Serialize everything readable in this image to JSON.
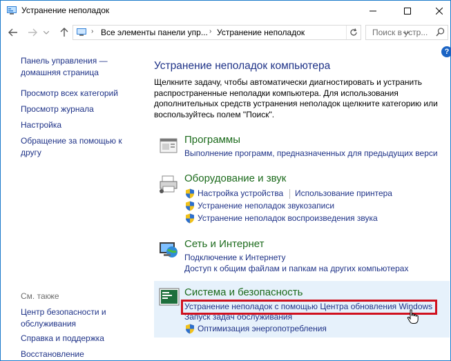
{
  "window": {
    "title": "Устранение неполадок"
  },
  "address": {
    "crumbs": [
      "Все элементы панели упр...",
      "Устранение неполадок"
    ],
    "search_placeholder": "Поиск в устр..."
  },
  "sidebar": {
    "items": [
      {
        "label": "Панель управления — домашняя страница"
      },
      {
        "label": "Просмотр всех категорий"
      },
      {
        "label": "Просмотр журнала"
      },
      {
        "label": "Настройка"
      },
      {
        "label": "Обращение за помощью к другу"
      }
    ],
    "see_also_label": "См. также",
    "see_also": [
      {
        "label": "Центр безопасности и обслуживания"
      },
      {
        "label": "Справка и поддержка"
      },
      {
        "label": "Восстановление"
      }
    ]
  },
  "main": {
    "title": "Устранение неполадок компьютера",
    "description": "Щелкните задачу, чтобы автоматически диагностировать и устранить распространенные неполадки компьютера. Для использования дополнительных средств устранения неполадок щелкните категорию или воспользуйтесь полем \"Поиск\".",
    "categories": [
      {
        "title": "Программы",
        "links": [
          "Выполнение программ, предназначенных для предыдущих верси"
        ]
      },
      {
        "title": "Оборудование и звук",
        "links": [
          "Настройка устройства",
          "Использование принтера",
          "Устранение неполадок звукозаписи",
          "Устранение неполадок воспроизведения звука"
        ]
      },
      {
        "title": "Сеть и Интернет",
        "links": [
          "Подключение к Интернету",
          "Доступ к общим файлам и папкам на других компьютерах"
        ]
      },
      {
        "title": "Система и безопасность",
        "links": [
          "Устранение неполадок с помощью Центра обновления Windows",
          "Запуск задач обслуживания",
          "Оптимизация энергопотребления"
        ]
      }
    ]
  },
  "colors": {
    "link": "#1e3287",
    "category_title": "#1b6a1b",
    "highlight": "#d0101e",
    "selection": "#e6f1fb"
  }
}
